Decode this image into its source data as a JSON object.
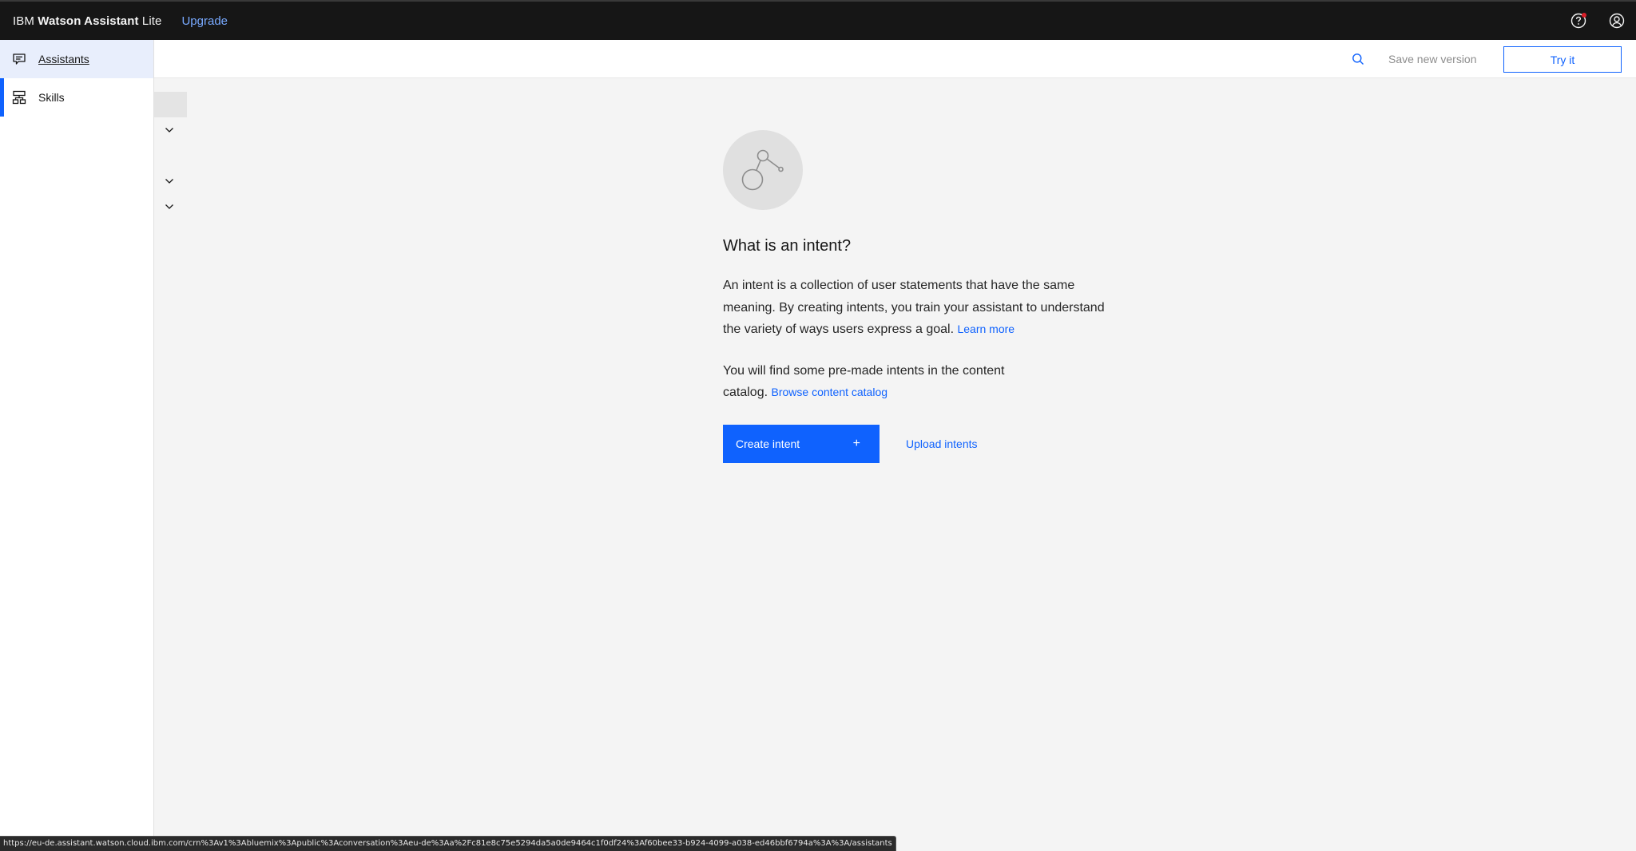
{
  "header": {
    "brand_prefix": "IBM",
    "brand_name": "Watson Assistant",
    "brand_plan": "Lite",
    "upgrade_label": "Upgrade",
    "icons": [
      "help-icon",
      "user-avatar-icon"
    ],
    "notification_color": "#da1e28"
  },
  "sidebar": {
    "items": [
      {
        "label": "Assistants",
        "icon": "chat-icon",
        "state": "hover"
      },
      {
        "label": "Skills",
        "icon": "skills-tree-icon",
        "state": "selected"
      }
    ]
  },
  "actionbar": {
    "search_icon": "search-icon",
    "save_version_label": "Save new version",
    "try_it_label": "Try it"
  },
  "subnav": {
    "chevrons": [
      "chevron-down-icon",
      "chevron-down-icon",
      "chevron-down-icon"
    ]
  },
  "empty_state": {
    "illustration": "intent-nodes-icon",
    "title": "What is an intent?",
    "paragraph1": "An intent is a collection of user statements that have the same meaning. By creating intents, you train your assistant to understand the variety of ways users express a goal.",
    "learn_more_label": "Learn more",
    "paragraph2": "You will find some pre-made intents in the content catalog.",
    "browse_catalog_label": "Browse content catalog",
    "create_intent_label": "Create intent",
    "create_intent_icon": "+",
    "upload_intents_label": "Upload intents"
  },
  "statusbar": {
    "url": "https://eu-de.assistant.watson.cloud.ibm.com/crn%3Av1%3Abluemix%3Apublic%3Aconversation%3Aeu-de%3Aa%2Fc81e8c75e5294da5a0de9464c1f0df24%3Af60bee33-b924-4099-a038-ed46bbf6794a%3A%3A/assistants"
  },
  "colors": {
    "primary": "#0f62fe",
    "header_bg": "#161616",
    "link_dark": "#78a9ff",
    "page_bg": "#f4f4f4"
  }
}
